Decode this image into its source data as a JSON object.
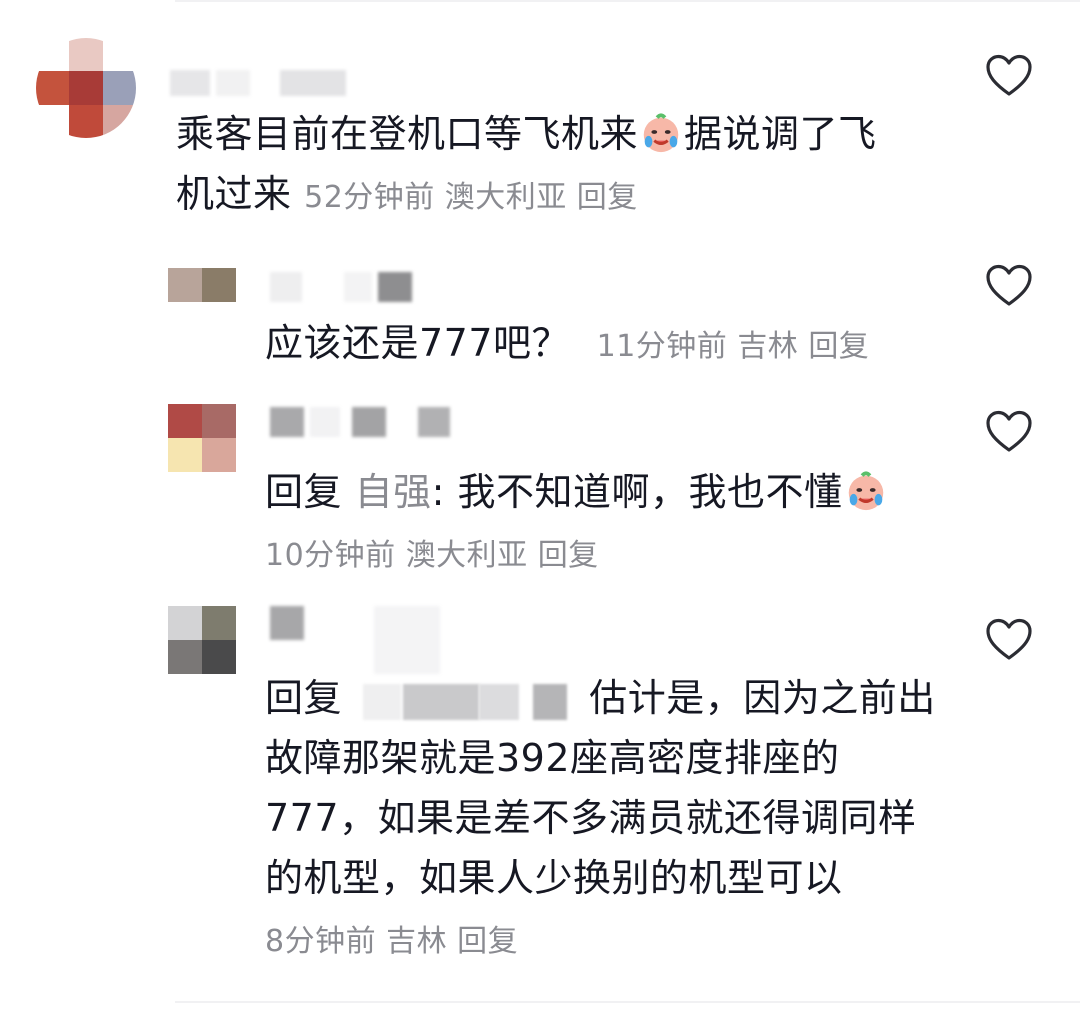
{
  "comments": [
    {
      "text_line1": "乘客目前在登机口等飞机来",
      "text_line1_after": "据说调了飞",
      "text_line2": "机过来",
      "time": "52分钟前",
      "location": "澳大利亚",
      "reply": "回复"
    },
    {
      "text": "应该还是777吧？",
      "time": "11分钟前",
      "location": "吉林",
      "reply": "回复"
    },
    {
      "reply_prefix": "回复",
      "reply_target": "自强",
      "text": ": 我不知道啊，我也不懂",
      "time": "10分钟前",
      "location": "澳大利亚",
      "reply": "回复"
    },
    {
      "reply_prefix": "回复",
      "text_line1": "估计是，因为之前出",
      "text_line2": "故障那架就是392座高密度排座的",
      "text_line3": "777，如果是差不多满员就还得调同样",
      "text_line4": "的机型，如果人少换别的机型可以",
      "time": "8分钟前",
      "location": "吉林",
      "reply": "回复"
    }
  ],
  "colors": {
    "primary_text": "#161823",
    "secondary_text": "#8a8b91",
    "divider": "#f1f1f3"
  },
  "icons": {
    "like": "heart-outline-icon",
    "emoji": "crying-face-emoji"
  }
}
